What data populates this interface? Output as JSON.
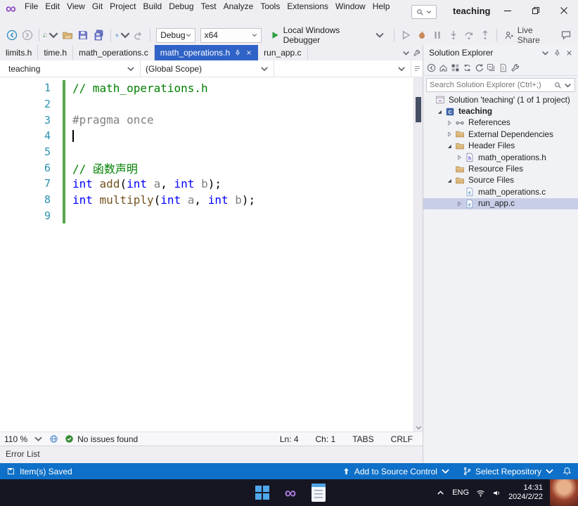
{
  "colors": {
    "active_tab": "#3063C6",
    "statusbar_blue": "#0E70C8",
    "success_green": "#388A34",
    "comment_green": "#008000",
    "keyword_blue": "#0000FF",
    "function_brown": "#74531F",
    "line_number_teal": "#2B91AF",
    "change_bar_green": "#57A64A",
    "taskbar_dark": "#151621"
  },
  "titlebar": {
    "title": "teaching",
    "menu": [
      "File",
      "Edit",
      "View",
      "Git",
      "Project",
      "Build",
      "Debug",
      "Test",
      "Analyze",
      "Tools",
      "Extensions",
      "Window",
      "Help"
    ],
    "icons": [
      "visual-studio-logo",
      "search",
      "chevron-down",
      "minimize",
      "restore",
      "close"
    ]
  },
  "toolbar": {
    "items": [
      {
        "type": "icon",
        "name": "navigate-back"
      },
      {
        "type": "icon",
        "name": "navigate-forward"
      },
      {
        "type": "sep"
      },
      {
        "type": "icon",
        "name": "new-file",
        "dropdown": true
      },
      {
        "type": "icon",
        "name": "open-file"
      },
      {
        "type": "icon",
        "name": "save"
      },
      {
        "type": "icon",
        "name": "save-all"
      },
      {
        "type": "sep"
      },
      {
        "type": "icon",
        "name": "undo",
        "dropdown": true
      },
      {
        "type": "icon",
        "name": "redo"
      },
      {
        "type": "sep"
      },
      {
        "type": "combo",
        "name": "solution-configuration",
        "value": "Debug"
      },
      {
        "type": "combo",
        "name": "solution-platform",
        "value": "x64"
      },
      {
        "type": "run",
        "name": "start-debugging",
        "label": "Local Windows Debugger"
      },
      {
        "type": "sep"
      },
      {
        "type": "icon",
        "name": "start-without-debugging"
      },
      {
        "type": "icon",
        "name": "hot-reload"
      },
      {
        "type": "icon",
        "name": "break-all"
      },
      {
        "type": "icon",
        "name": "step-into"
      },
      {
        "type": "icon",
        "name": "step-over"
      },
      {
        "type": "icon",
        "name": "step-out"
      },
      {
        "type": "sep"
      },
      {
        "type": "liveshare",
        "name": "live-share",
        "label": "Live Share"
      },
      {
        "type": "icon",
        "name": "feedback"
      }
    ]
  },
  "tabs": [
    {
      "label": "limits.h",
      "active": false
    },
    {
      "label": "time.h",
      "active": false
    },
    {
      "label": "math_operations.c",
      "active": false
    },
    {
      "label": "math_operations.h",
      "active": true
    },
    {
      "label": "run_app.c",
      "active": false
    }
  ],
  "editor": {
    "nav_project": "teaching",
    "nav_scope": "(Global Scope)",
    "nav_member": "",
    "lines": [
      {
        "n": 1,
        "changed": true,
        "tokens": [
          [
            "cm",
            "// math_operations.h"
          ]
        ]
      },
      {
        "n": 2,
        "changed": true,
        "tokens": []
      },
      {
        "n": 3,
        "changed": true,
        "tokens": [
          [
            "pp",
            "#pragma once"
          ]
        ]
      },
      {
        "n": 4,
        "changed": true,
        "caret": true,
        "tokens": []
      },
      {
        "n": 5,
        "changed": true,
        "tokens": []
      },
      {
        "n": 6,
        "changed": true,
        "tokens": [
          [
            "cm",
            "// 函数声明"
          ]
        ]
      },
      {
        "n": 7,
        "changed": true,
        "tokens": [
          [
            "kw",
            "int"
          ],
          [
            "pl",
            " "
          ],
          [
            "fn",
            "add"
          ],
          [
            "pl",
            "("
          ],
          [
            "kw",
            "int"
          ],
          [
            "pr",
            " a"
          ],
          [
            "pl",
            ", "
          ],
          [
            "kw",
            "int"
          ],
          [
            "pr",
            " b"
          ],
          [
            "pl",
            ");"
          ]
        ]
      },
      {
        "n": 8,
        "changed": true,
        "tokens": [
          [
            "kw",
            "int"
          ],
          [
            "pl",
            " "
          ],
          [
            "fn",
            "multiply"
          ],
          [
            "pl",
            "("
          ],
          [
            "kw",
            "int"
          ],
          [
            "pr",
            " a"
          ],
          [
            "pl",
            ", "
          ],
          [
            "kw",
            "int"
          ],
          [
            "pr",
            " b"
          ],
          [
            "pl",
            ");"
          ]
        ]
      },
      {
        "n": 9,
        "changed": true,
        "tokens": []
      }
    ],
    "status": {
      "zoom": "110 %",
      "issues": "No issues found",
      "ln": "Ln: 4",
      "ch": "Ch: 1",
      "tabs": "TABS",
      "eol": "CRLF"
    }
  },
  "error_list_label": "Error List",
  "solution_explorer": {
    "title": "Solution Explorer",
    "search_placeholder": "Search Solution Explorer (Ctrl+;)",
    "header_icons": [
      "chevron-down",
      "pin",
      "close"
    ],
    "toolbar_icons": [
      "back",
      "home",
      "switch-views",
      "sync-active-document",
      "refresh",
      "collapse-all",
      "show-all-files",
      "properties"
    ],
    "tree": [
      {
        "label": "Solution 'teaching' (1 of 1 project)",
        "indent": 0,
        "icon": "solution",
        "arrow": "none"
      },
      {
        "label": "teaching",
        "indent": 1,
        "icon": "project",
        "arrow": "expanded",
        "bold": true
      },
      {
        "label": "References",
        "indent": 2,
        "icon": "references",
        "arrow": "collapsed"
      },
      {
        "label": "External Dependencies",
        "indent": 2,
        "icon": "folder",
        "arrow": "collapsed"
      },
      {
        "label": "Header Files",
        "indent": 2,
        "icon": "folder",
        "arrow": "expanded"
      },
      {
        "label": "math_operations.h",
        "indent": 3,
        "icon": "file-h",
        "arrow": "collapsed"
      },
      {
        "label": "Resource Files",
        "indent": 2,
        "icon": "folder",
        "arrow": "none"
      },
      {
        "label": "Source Files",
        "indent": 2,
        "icon": "folder",
        "arrow": "expanded"
      },
      {
        "label": "math_operations.c",
        "indent": 3,
        "icon": "file-c",
        "arrow": "none"
      },
      {
        "label": "run_app.c",
        "indent": 3,
        "icon": "file-c",
        "arrow": "collapsed",
        "selected": true
      }
    ]
  },
  "app_statusbar": {
    "left": "Item(s) Saved",
    "add_source_control": "Add to Source Control",
    "select_repository": "Select Repository"
  },
  "taskbar": {
    "language": "ENG",
    "time": "14:31",
    "date": "2024/2/22"
  }
}
